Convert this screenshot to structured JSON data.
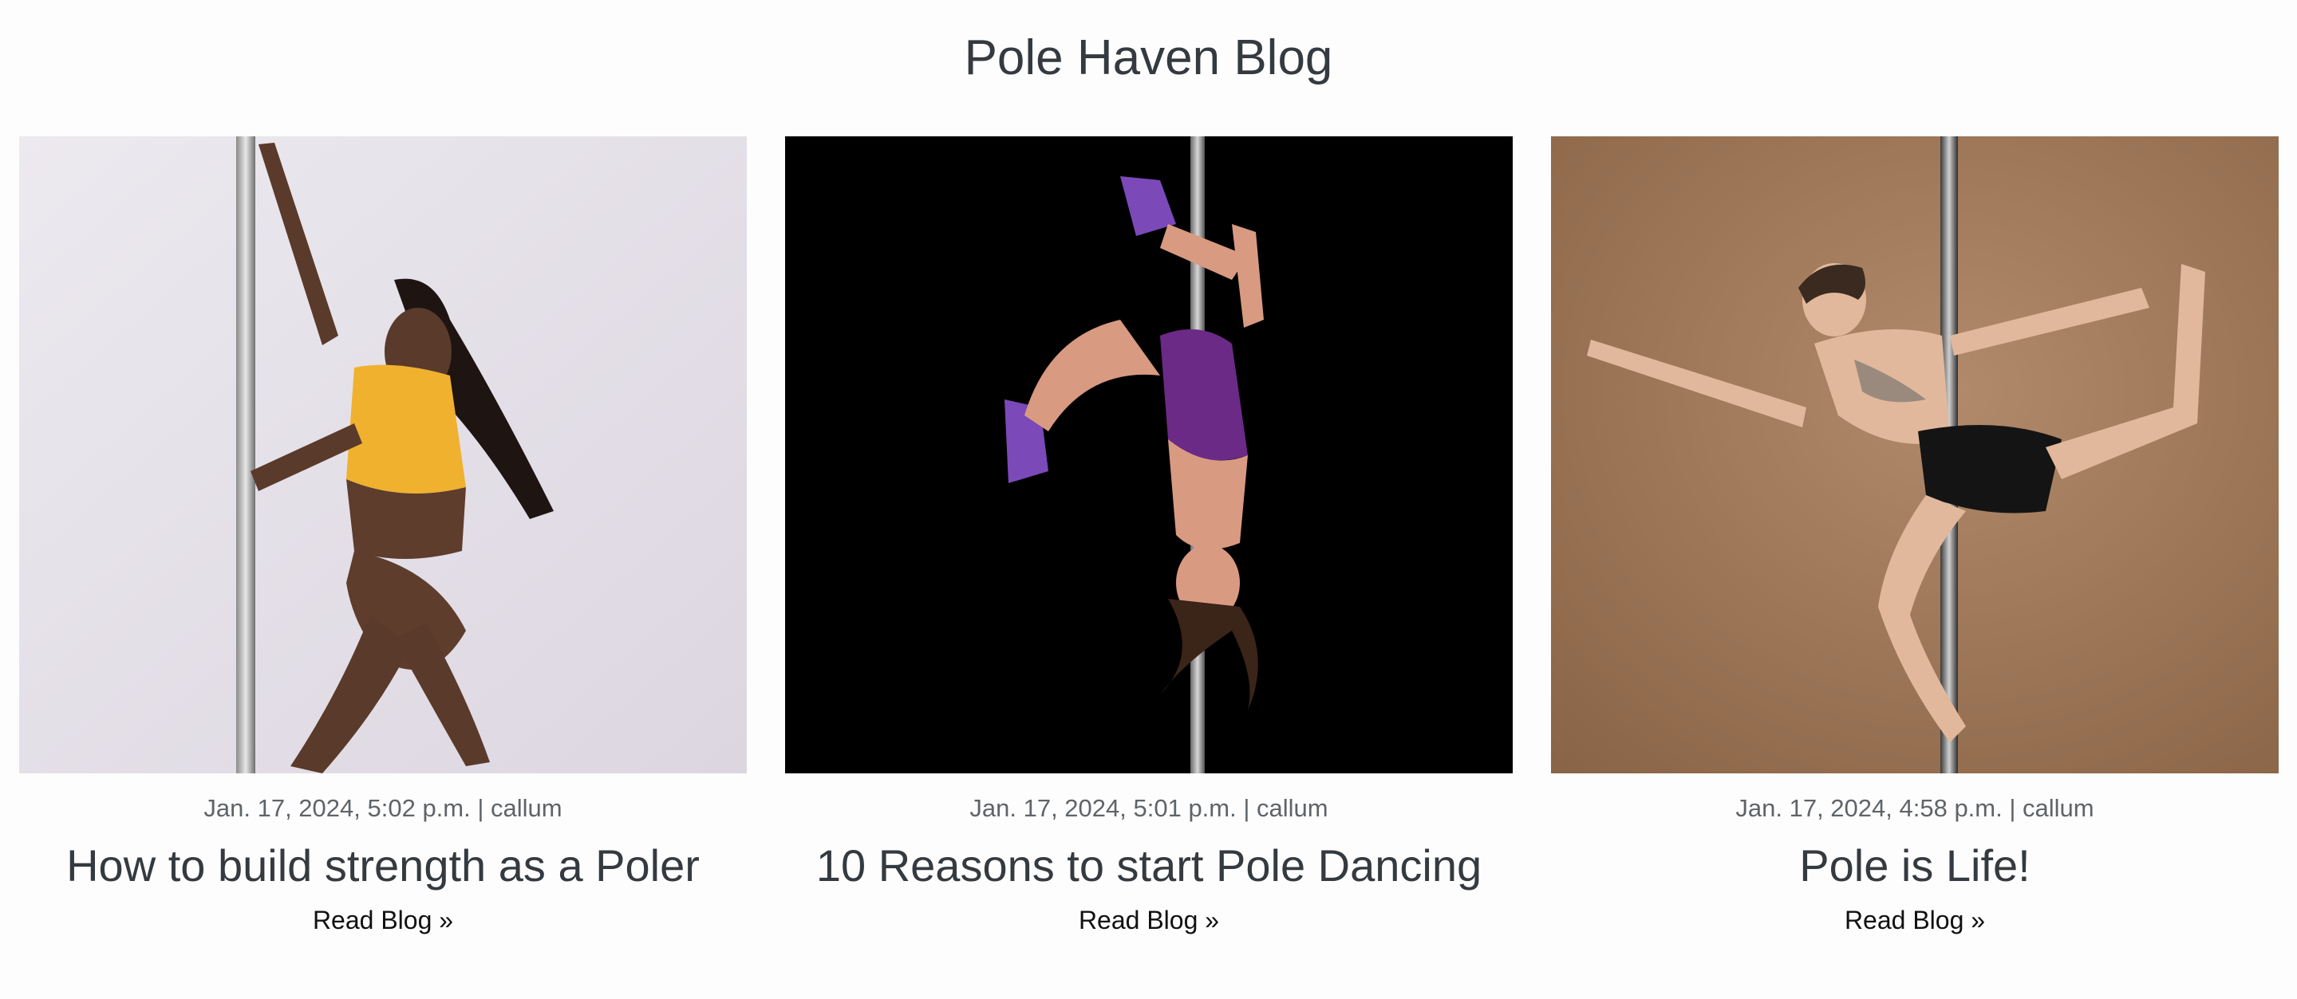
{
  "page": {
    "heading": "Pole Haven Blog"
  },
  "posts": [
    {
      "meta": "Jan. 17, 2024, 5:02 p.m. | callum",
      "title": "How to build strength as a Poler",
      "link_label": "Read Blog »",
      "image_background": "#e6e2ea"
    },
    {
      "meta": "Jan. 17, 2024, 5:01 p.m. | callum",
      "title": "10 Reasons to start Pole Dancing",
      "link_label": "Read Blog »",
      "image_background": "#000000"
    },
    {
      "meta": "Jan. 17, 2024, 4:58 p.m. | callum",
      "title": "Pole is Life!",
      "link_label": "Read Blog »",
      "image_background": "#9a7558"
    }
  ]
}
